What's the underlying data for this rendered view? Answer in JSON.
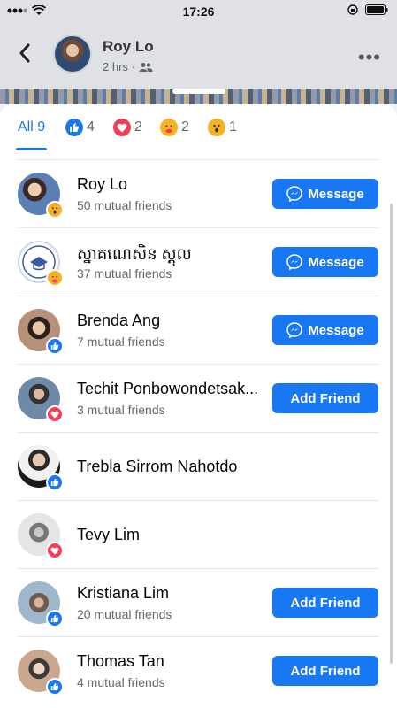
{
  "status_bar": {
    "time": "17:26"
  },
  "header": {
    "name": "Roy Lo",
    "meta": "2 hrs ·"
  },
  "tabs": [
    {
      "label": "All 9",
      "count": "",
      "icon": "none"
    },
    {
      "label": "",
      "count": "4",
      "icon": "like-icon"
    },
    {
      "label": "",
      "count": "2",
      "icon": "love-icon"
    },
    {
      "label": "",
      "count": "2",
      "icon": "care-icon"
    },
    {
      "label": "",
      "count": "1",
      "icon": "wow-icon"
    }
  ],
  "rows": [
    {
      "name": "Roy Lo",
      "mutual": "50 mutual friends",
      "button": "Message",
      "reaction": "wow-icon"
    },
    {
      "name": "ស្នាគណេសិន ស្ដុល",
      "mutual": "37 mutual friends",
      "button": "Message",
      "reaction": "care-icon"
    },
    {
      "name": "Brenda Ang",
      "mutual": "7 mutual friends",
      "button": "Message",
      "reaction": "like-icon"
    },
    {
      "name": "Techit Ponbowondetsak...",
      "mutual": "3 mutual friends",
      "button": "Add Friend",
      "reaction": "love-icon"
    },
    {
      "name": "Trebla Sirrom Nahotdo",
      "mutual": "",
      "button": "",
      "reaction": "like-icon"
    },
    {
      "name": "Tevy Lim",
      "mutual": "",
      "button": "",
      "reaction": "love-icon"
    },
    {
      "name": "Kristiana Lim",
      "mutual": "20 mutual friends",
      "button": "Add Friend",
      "reaction": "like-icon"
    },
    {
      "name": "Thomas Tan",
      "mutual": "4 mutual friends",
      "button": "Add Friend",
      "reaction": "like-icon"
    }
  ],
  "colors": {
    "accent": "#1877f2",
    "love": "#f33e58",
    "wow": "#f7b125"
  }
}
